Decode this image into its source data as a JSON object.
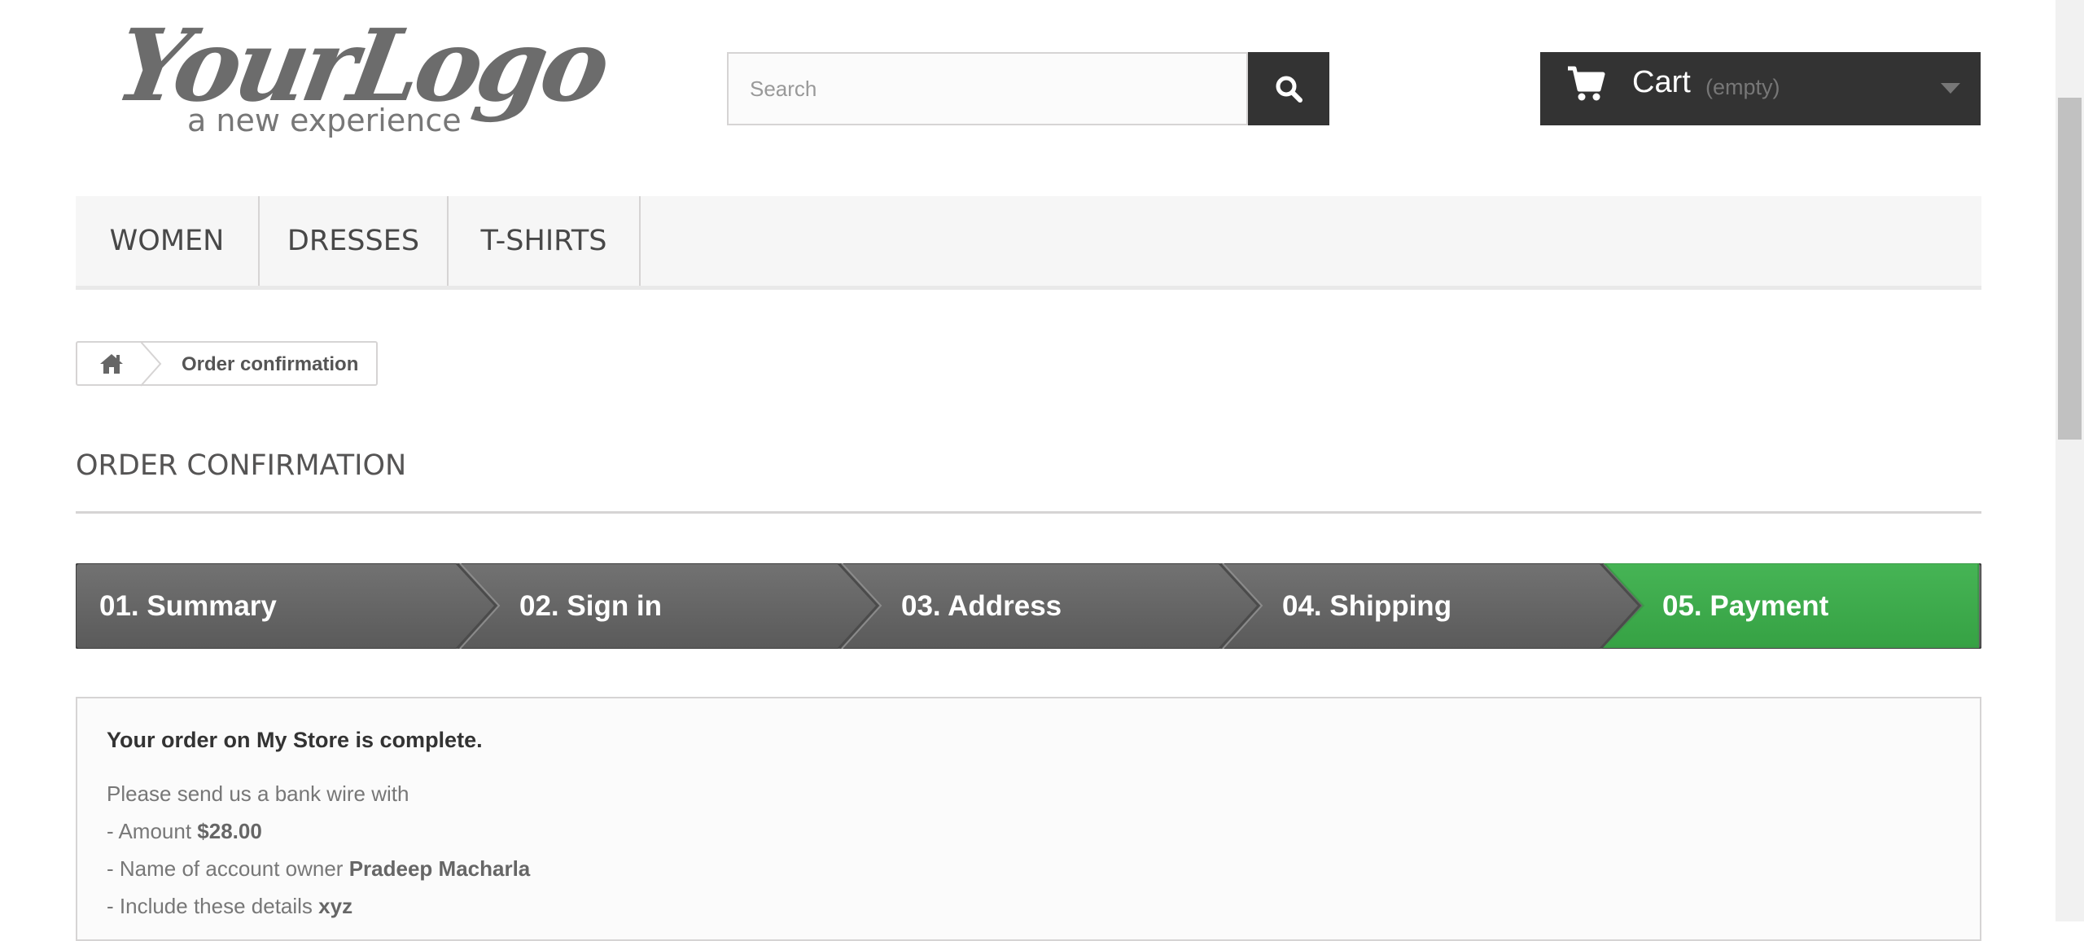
{
  "header": {
    "logo_text": "YourLogo",
    "logo_tagline": "a new experience",
    "search": {
      "placeholder": "Search",
      "value": ""
    },
    "search_button_icon": "search-icon",
    "cart": {
      "label": "Cart",
      "status": "(empty)",
      "icon": "shopping-cart-icon"
    }
  },
  "menu": {
    "items": [
      {
        "label": "WOMEN"
      },
      {
        "label": "DRESSES"
      },
      {
        "label": "T-SHIRTS"
      }
    ]
  },
  "breadcrumb": {
    "home_icon": "home-icon",
    "current": "Order confirmation"
  },
  "page": {
    "title": "ORDER CONFIRMATION"
  },
  "steps": [
    {
      "label": "01. Summary",
      "state": "done"
    },
    {
      "label": "02. Sign in",
      "state": "done"
    },
    {
      "label": "03. Address",
      "state": "done"
    },
    {
      "label": "04. Shipping",
      "state": "done"
    },
    {
      "label": "05. Payment",
      "state": "current"
    }
  ],
  "colors": {
    "step_done": "#646464",
    "step_current": "#3aa74a",
    "dark": "#333333"
  },
  "confirmation": {
    "heading": "Your order on My Store is complete.",
    "intro": "Please send us a bank wire with",
    "amount_label": "- Amount ",
    "amount_value": "$28.00",
    "owner_label": "- Name of account owner ",
    "owner_value": "Pradeep Macharla",
    "details_label": "- Include these details ",
    "details_value": "xyz"
  }
}
